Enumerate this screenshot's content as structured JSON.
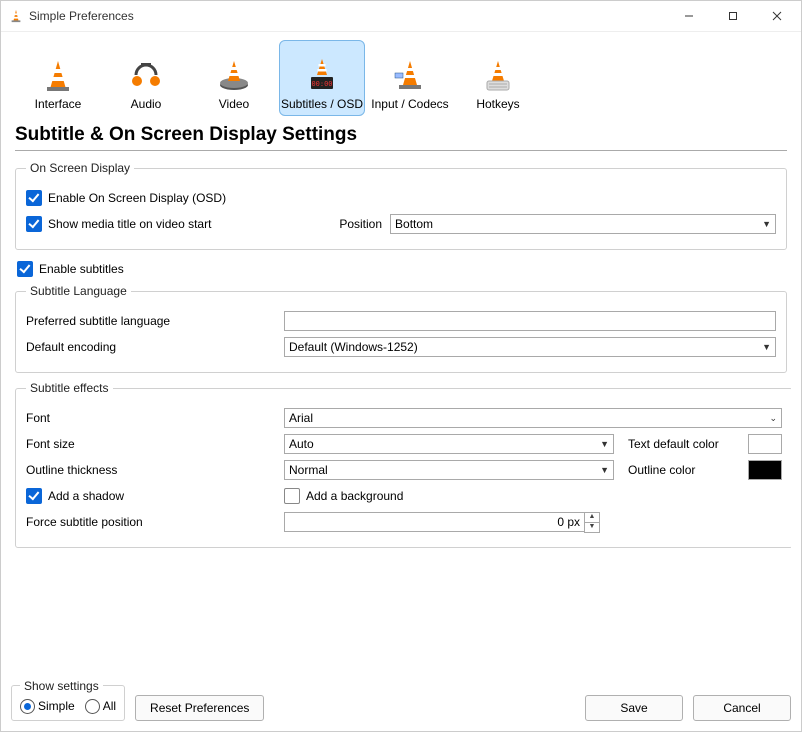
{
  "window": {
    "title": "Simple Preferences"
  },
  "tabs": {
    "interface": "Interface",
    "audio": "Audio",
    "video": "Video",
    "subtitles": "Subtitles / OSD",
    "input": "Input / Codecs",
    "hotkeys": "Hotkeys"
  },
  "page": {
    "title": "Subtitle & On Screen Display Settings"
  },
  "osd": {
    "legend": "On Screen Display",
    "enable_osd": "Enable On Screen Display (OSD)",
    "show_title": "Show media title on video start",
    "position_label": "Position",
    "position_value": "Bottom"
  },
  "enable_subs": "Enable subtitles",
  "lang": {
    "legend": "Subtitle Language",
    "preferred_label": "Preferred subtitle language",
    "preferred_value": "",
    "encoding_label": "Default encoding",
    "encoding_value": "Default (Windows-1252)"
  },
  "fx": {
    "legend": "Subtitle effects",
    "font_label": "Font",
    "font_value": "Arial",
    "fontsize_label": "Font size",
    "fontsize_value": "Auto",
    "textcolor_label": "Text default color",
    "outline_label": "Outline thickness",
    "outline_value": "Normal",
    "outlinecolor_label": "Outline color",
    "add_shadow": "Add a shadow",
    "add_background": "Add a background",
    "force_pos_label": "Force subtitle position",
    "force_pos_value": "0 px"
  },
  "footer": {
    "show_settings": "Show settings",
    "simple": "Simple",
    "all": "All",
    "reset": "Reset Preferences",
    "save": "Save",
    "cancel": "Cancel"
  },
  "colors": {
    "text_default": "#ffffff",
    "outline": "#000000"
  }
}
